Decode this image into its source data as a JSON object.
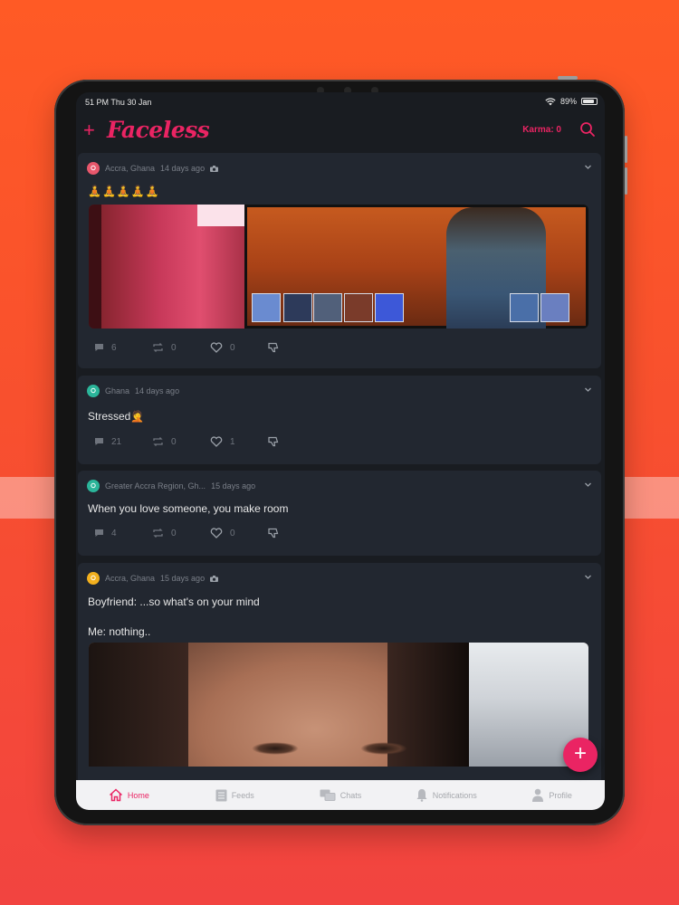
{
  "status_bar": {
    "time": "51 PM  Thu 30 Jan",
    "battery": "89%",
    "battery_level": 0.89
  },
  "header": {
    "add_label": "+",
    "logo": "Faceless",
    "karma": "Karma: 0"
  },
  "posts": [
    {
      "location": "Accra, Ghana",
      "time": "14 days ago",
      "has_photo": true,
      "pin_color": "#e8576c",
      "text": "",
      "emojis": "🧘🧘🧘🧘🧘",
      "comments": "6",
      "reposts": "0",
      "likes": "0"
    },
    {
      "location": "Ghana",
      "time": "14 days ago",
      "has_photo": false,
      "pin_color": "#2bb59a",
      "text": "Stressed🤦",
      "comments": "21",
      "reposts": "0",
      "likes": "1"
    },
    {
      "location": "Greater Accra Region, Gh...",
      "time": "15 days ago",
      "has_photo": false,
      "pin_color": "#2bb59a",
      "text": "When you love someone, you make room",
      "comments": "4",
      "reposts": "0",
      "likes": "0"
    },
    {
      "location": "Accra, Ghana",
      "time": "15 days ago",
      "has_photo": true,
      "pin_color": "#f2b01e",
      "text": "Boyfriend: ...so what's on your mind",
      "text2": "Me: nothing.."
    }
  ],
  "fab_label": "+",
  "tabs": [
    {
      "label": "Home",
      "icon": "home-icon",
      "active": true
    },
    {
      "label": "Feeds",
      "icon": "feeds-icon",
      "active": false
    },
    {
      "label": "Chats",
      "icon": "chats-icon",
      "active": false
    },
    {
      "label": "Notifications",
      "icon": "bell-icon",
      "active": false
    },
    {
      "label": "Profile",
      "icon": "person-icon",
      "active": false
    }
  ],
  "colors": {
    "accent": "#ea2463",
    "card": "#222730",
    "screen_bg": "#191c21",
    "tabbar": "#f2f2f4"
  }
}
